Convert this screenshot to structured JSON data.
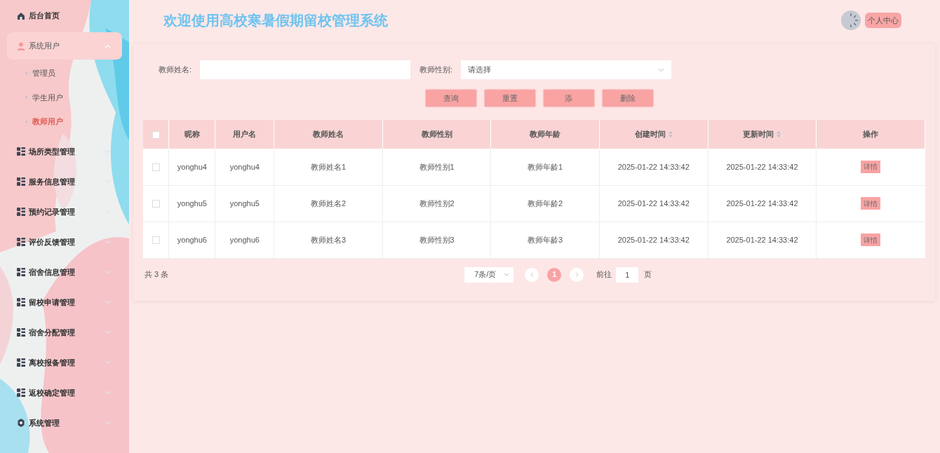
{
  "sidebar": {
    "items": [
      {
        "label": "后台首页",
        "kind": "home",
        "selected": false
      },
      {
        "label": "系统用户",
        "kind": "user",
        "selected": true,
        "expanded": true,
        "children": [
          {
            "label": "管理员",
            "selected": false
          },
          {
            "label": "学生用户",
            "selected": false
          },
          {
            "label": "教师用户",
            "selected": true
          }
        ]
      },
      {
        "label": "场所类型管理",
        "kind": "grid",
        "selected": false,
        "expanded": false
      },
      {
        "label": "服务信息管理",
        "kind": "grid",
        "selected": false,
        "expanded": false
      },
      {
        "label": "预约记录管理",
        "kind": "grid",
        "selected": false,
        "expanded": false
      },
      {
        "label": "评价反馈管理",
        "kind": "grid",
        "selected": false,
        "expanded": false
      },
      {
        "label": "宿舍信息管理",
        "kind": "grid",
        "selected": false,
        "expanded": false
      },
      {
        "label": "留校申请管理",
        "kind": "grid",
        "selected": false,
        "expanded": false
      },
      {
        "label": "宿舍分配管理",
        "kind": "grid",
        "selected": false,
        "expanded": false
      },
      {
        "label": "离校报备管理",
        "kind": "grid",
        "selected": false,
        "expanded": false
      },
      {
        "label": "返校确定管理",
        "kind": "grid",
        "selected": false,
        "expanded": false
      },
      {
        "label": "系统管理",
        "kind": "gear",
        "selected": false,
        "expanded": false
      }
    ]
  },
  "header": {
    "title": "欢迎使用高校寒暑假期留校管理系统",
    "profile_button": "个人中心"
  },
  "filters": [
    {
      "label": "教师姓名:",
      "kind": "text"
    },
    {
      "label": "教师性别:",
      "kind": "select",
      "placeholder": "请选择"
    }
  ],
  "buttons": [
    "查询",
    "重置",
    "添",
    "删除"
  ],
  "table": {
    "select_all_checked": false,
    "columns": [
      {
        "label": "昵称",
        "sortable": false
      },
      {
        "label": "用户名",
        "sortable": false
      },
      {
        "label": "教师姓名",
        "sortable": false
      },
      {
        "label": "教师性别",
        "sortable": false
      },
      {
        "label": "教师年龄",
        "sortable": false
      },
      {
        "label": "创建时间",
        "sortable": true
      },
      {
        "label": "更新时间",
        "sortable": true
      },
      {
        "label": "操作",
        "sortable": false
      }
    ],
    "rows": [
      {
        "checked": false,
        "cells": [
          "yonghu4",
          "yonghu4",
          "教师姓名1",
          "教师性别1",
          "教师年龄1",
          "2025-01-22 14:33:42",
          "2025-01-22 14:33:42"
        ],
        "action": "详情"
      },
      {
        "checked": false,
        "cells": [
          "yonghu5",
          "yonghu5",
          "教师姓名2",
          "教师性别2",
          "教师年龄2",
          "2025-01-22 14:33:42",
          "2025-01-22 14:33:42"
        ],
        "action": "详情"
      },
      {
        "checked": false,
        "cells": [
          "yonghu6",
          "yonghu6",
          "教师姓名3",
          "教师性别3",
          "教师年龄3",
          "2025-01-22 14:33:42",
          "2025-01-22 14:33:42"
        ],
        "action": "详情"
      }
    ]
  },
  "pagination": {
    "total": "共 3 条",
    "page_size": "7条/页",
    "pages": [
      {
        "label": "1",
        "selected": true
      }
    ],
    "goto_label": "前往",
    "goto_value": "1",
    "goto_suffix": "页"
  }
}
